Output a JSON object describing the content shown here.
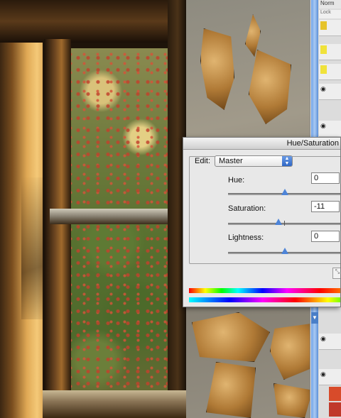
{
  "dialog": {
    "title": "Hue/Saturation",
    "edit_label": "Edit:",
    "edit_value": "Master",
    "hue": {
      "label": "Hue:",
      "value": "0",
      "slider_fraction": 0.5
    },
    "saturation": {
      "label": "Saturation:",
      "value": "-11",
      "slider_fraction": 0.445
    },
    "lightness": {
      "label": "Lightness:",
      "value": "0",
      "slider_fraction": 0.5
    }
  },
  "panel": {
    "top_tag": "Norm",
    "lock_label": "Lock",
    "swatch_colors": [
      "#e6c32b",
      "#f0e23a",
      "#d84b2a",
      "#c9c9c9"
    ]
  },
  "icons": [
    "select-arrow-icon",
    "eye-icon",
    "expand-icon",
    "scroll-down-arrow-icon"
  ],
  "colors": {
    "dialog_bg": "#e8e8e8",
    "accent": "#2f67c5",
    "slider_thumb": "#4d84d8"
  }
}
